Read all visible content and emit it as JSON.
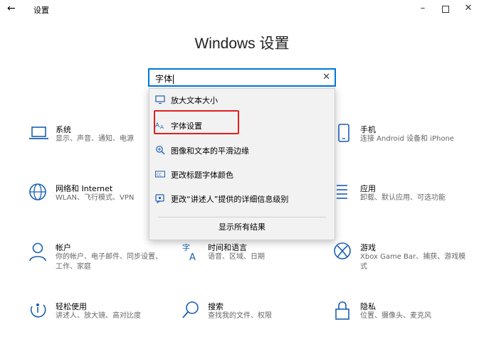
{
  "titlebar": {
    "back_icon": "back-arrow-icon",
    "title": "设置",
    "minimize_icon": "minimize-icon",
    "maximize_icon": "maximize-icon",
    "close_icon": "close-icon"
  },
  "heading": "Windows 设置",
  "search": {
    "value": "字体",
    "clear_icon": "clear-icon"
  },
  "dropdown": {
    "items": [
      {
        "label": "放大文本大小",
        "icon": "display-icon"
      },
      {
        "label": "字体设置",
        "icon": "font-icon"
      },
      {
        "label": "图像和文本的平滑边缘",
        "icon": "magnifier-icon"
      },
      {
        "label": "更改标题字体颜色",
        "icon": "color-icon"
      },
      {
        "label": "更改“讲述人”提供的详细信息级别",
        "icon": "narrator-icon"
      }
    ],
    "footer": "显示所有结果",
    "highlight_color": "#e02020"
  },
  "tiles": [
    {
      "name": "系统",
      "desc": "显示、声音、通知、电源",
      "icon": "laptop-icon"
    },
    {
      "name": "手机",
      "desc": "连接 Android 设备和 iPhone",
      "icon": "phone-icon"
    },
    {
      "name": "网络和 Internet",
      "desc": "WLAN、飞行模式、VPN",
      "icon": "globe-icon"
    },
    {
      "name": "应用",
      "desc": "卸载、默认应用、可选功能",
      "icon": "apps-icon"
    },
    {
      "name": "帐户",
      "desc": "你的帐户、电子邮件、同步设置、工作、家庭",
      "icon": "person-icon"
    },
    {
      "name": "时间和语言",
      "desc": "语音、区域、日期",
      "icon": "time-language-icon"
    },
    {
      "name": "游戏",
      "desc": "Xbox Game Bar、捕获、游戏模式",
      "icon": "xbox-icon"
    },
    {
      "name": "轻松使用",
      "desc": "讲述人、放大镜、高对比度",
      "icon": "ease-of-access-icon"
    },
    {
      "name": "搜索",
      "desc": "查找我的文件、权限",
      "icon": "search-icon"
    },
    {
      "name": "隐私",
      "desc": "位置、摄像头、麦克风",
      "icon": "lock-icon"
    }
  ],
  "accent_color": "#0078d7"
}
